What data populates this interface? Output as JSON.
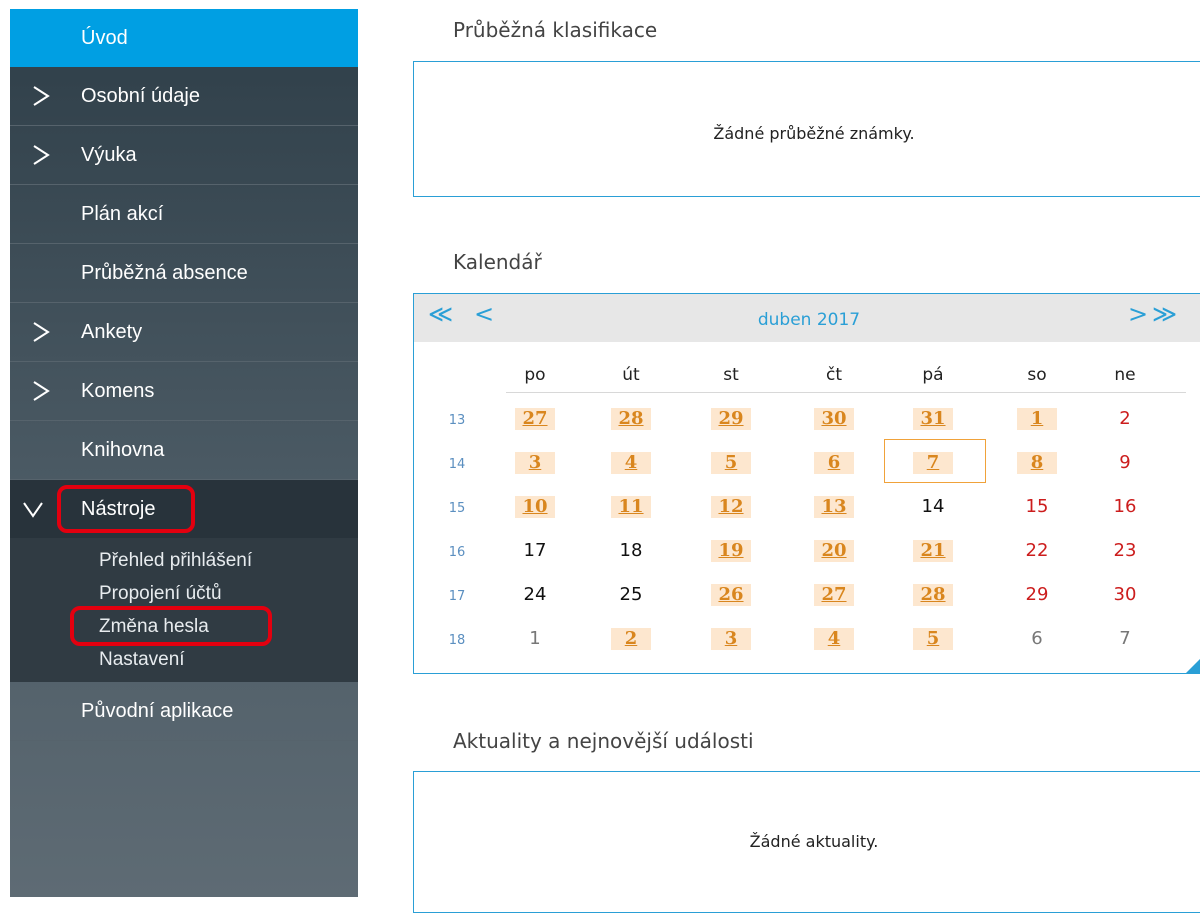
{
  "sidebar": {
    "items": [
      {
        "label": "Úvod"
      },
      {
        "label": "Osobní údaje"
      },
      {
        "label": "Výuka"
      },
      {
        "label": "Plán akcí"
      },
      {
        "label": "Průběžná absence"
      },
      {
        "label": "Ankety"
      },
      {
        "label": "Komens"
      },
      {
        "label": "Knihovna"
      },
      {
        "label": "Nástroje"
      },
      {
        "label": "Původní aplikace"
      }
    ],
    "tools_submenu": [
      {
        "label": "Přehled přihlášení"
      },
      {
        "label": "Propojení účtů"
      },
      {
        "label": "Změna hesla"
      },
      {
        "label": "Nastavení"
      }
    ],
    "colors": {
      "active": "#009fe3",
      "highlight_ring": "#e3000f"
    }
  },
  "grades": {
    "title": "Průběžná klasifikace",
    "empty": "Žádné průběžné známky."
  },
  "calendar": {
    "title": "Kalendář",
    "month": "duben 2017",
    "nav": {
      "first": "≪",
      "prev": "<",
      "next": ">",
      "last": "≫"
    },
    "weekdays": [
      "po",
      "út",
      "st",
      "čt",
      "pá",
      "so",
      "ne"
    ],
    "weeks": [
      {
        "num": "13",
        "days": [
          "27",
          "28",
          "29",
          "30",
          "31",
          "1",
          "2"
        ]
      },
      {
        "num": "14",
        "days": [
          "3",
          "4",
          "5",
          "6",
          "7",
          "8",
          "9"
        ]
      },
      {
        "num": "15",
        "days": [
          "10",
          "11",
          "12",
          "13",
          "14",
          "15",
          "16"
        ]
      },
      {
        "num": "16",
        "days": [
          "17",
          "18",
          "19",
          "20",
          "21",
          "22",
          "23"
        ]
      },
      {
        "num": "17",
        "days": [
          "24",
          "25",
          "26",
          "27",
          "28",
          "29",
          "30"
        ]
      },
      {
        "num": "18",
        "days": [
          "1",
          "2",
          "3",
          "4",
          "5",
          "6",
          "7"
        ]
      }
    ],
    "add_label": "+"
  },
  "news": {
    "title": "Aktuality a nejnovější události",
    "empty": "Žádné aktuality."
  }
}
